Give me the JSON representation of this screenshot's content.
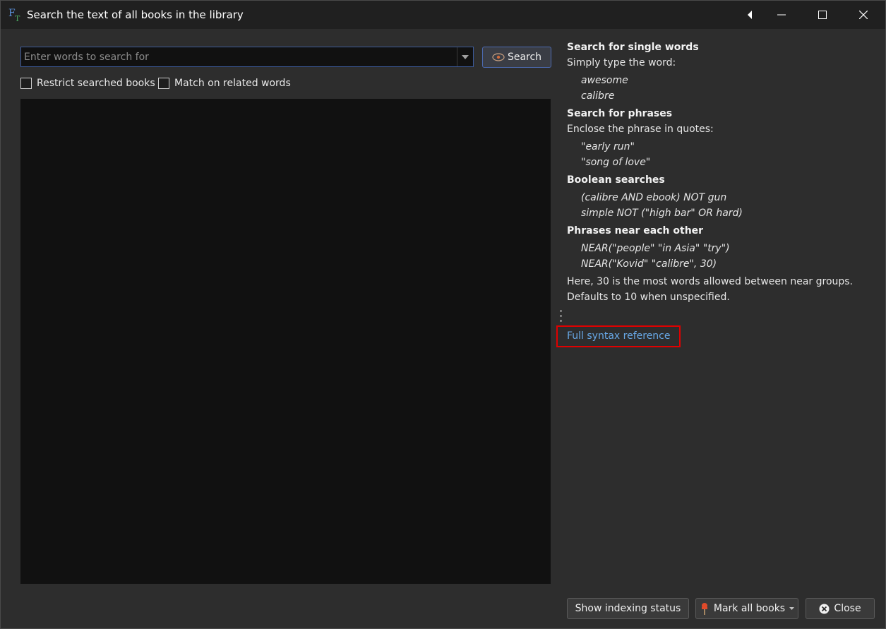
{
  "window": {
    "title": "Search the text of all books in the library"
  },
  "search": {
    "placeholder": "Enter words to search for",
    "value": "",
    "button_label": "Search"
  },
  "options": {
    "restrict_label": "Restrict searched books",
    "restrict_checked": false,
    "related_label": "Match on related words",
    "related_checked": false
  },
  "help": {
    "s1_heading": "Search for single words",
    "s1_text": "Simply type the word:",
    "s1_ex1": "awesome",
    "s1_ex2": "calibre",
    "s2_heading": "Search for phrases",
    "s2_text": "Enclose the phrase in quotes:",
    "s2_ex1": "\"early run\"",
    "s2_ex2": "\"song of love\"",
    "s3_heading": "Boolean searches",
    "s3_ex1": "(calibre AND ebook) NOT gun",
    "s3_ex2": "simple NOT (\"high bar\" OR hard)",
    "s4_heading": "Phrases near each other",
    "s4_ex1": "NEAR(\"people\" \"in Asia\" \"try\")",
    "s4_ex2": "NEAR(\"Kovid\" \"calibre\", 30)",
    "s4_note1": "Here, 30 is the most words allowed between near groups.",
    "s4_note2": "Defaults to 10 when unspecified.",
    "link_label": "Full syntax reference"
  },
  "footer": {
    "indexing_label": "Show indexing status",
    "mark_label": "Mark all books",
    "close_label": "Close"
  },
  "colors": {
    "accent_link": "#68a8e6",
    "highlight_box": "#e00000",
    "focus_border": "#3c5a9a"
  }
}
